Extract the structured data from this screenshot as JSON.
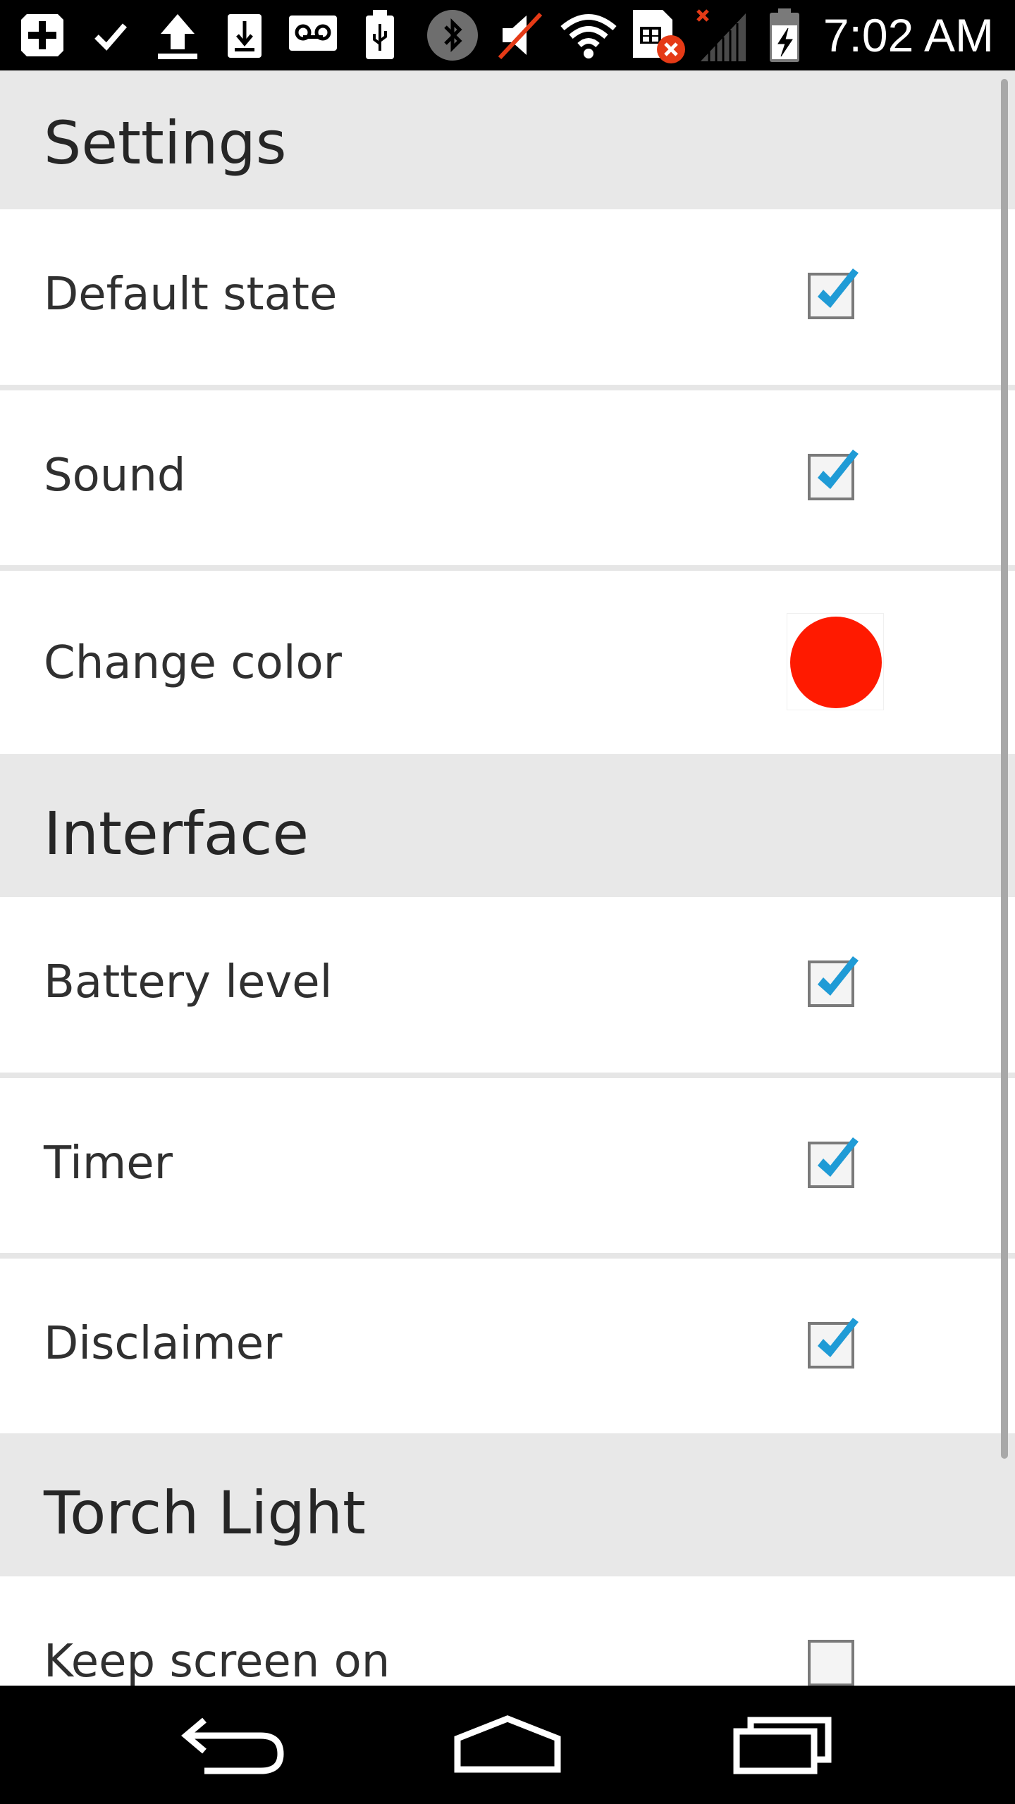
{
  "status_bar": {
    "time": "7:02 AM",
    "icons": [
      "add-box-icon",
      "check-icon",
      "upload-icon",
      "download-icon",
      "voicemail-icon",
      "usb-icon",
      "bluetooth-icon",
      "muted-icon",
      "wifi-icon",
      "sim-error-icon",
      "signal-icon",
      "battery-charging-icon"
    ]
  },
  "sections": [
    {
      "title": "Settings"
    },
    {
      "title": "Interface"
    },
    {
      "title": "Torch Light"
    }
  ],
  "settings": {
    "default_state": {
      "label": "Default state",
      "checked": true
    },
    "sound": {
      "label": "Sound",
      "checked": true
    },
    "change_color": {
      "label": "Change color",
      "color": "#ff1a00"
    }
  },
  "interface": {
    "battery_level": {
      "label": "Battery level",
      "checked": true
    },
    "timer": {
      "label": "Timer",
      "checked": true
    },
    "disclaimer": {
      "label": "Disclaimer",
      "checked": true
    }
  },
  "torch_light": {
    "keep_screen_on": {
      "label": "Keep screen on",
      "checked": false
    }
  },
  "colors": {
    "accent": "#1f9bd6",
    "section_bg": "#e8e8e8",
    "status_bar": "#000000"
  },
  "navigation": {
    "buttons": [
      "back-icon",
      "home-icon",
      "recents-icon"
    ]
  }
}
